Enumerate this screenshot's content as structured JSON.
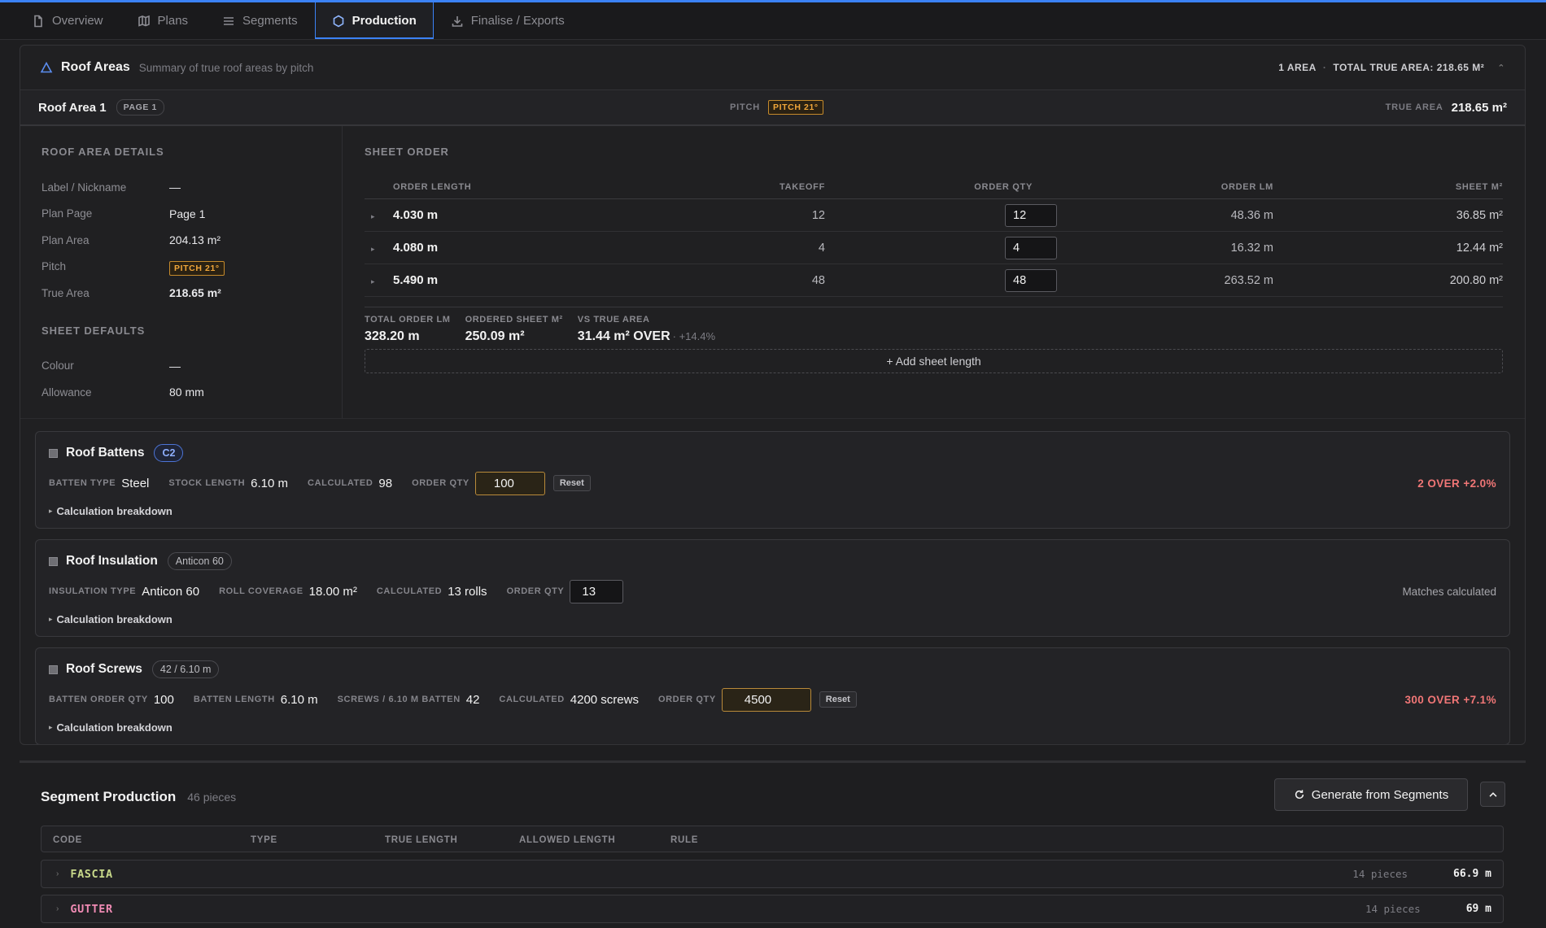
{
  "tabs": [
    {
      "label": "Overview",
      "icon": "document-icon"
    },
    {
      "label": "Plans",
      "icon": "map-icon"
    },
    {
      "label": "Segments",
      "icon": "list-icon"
    },
    {
      "label": "Production",
      "icon": "hexagon-icon"
    },
    {
      "label": "Finalise / Exports",
      "icon": "download-icon"
    }
  ],
  "roof_areas": {
    "title": "Roof Areas",
    "subtitle": "Summary of true roof areas by pitch",
    "area_count": "1 AREA",
    "total_true_area": "TOTAL TRUE AREA: 218.65 M²"
  },
  "area": {
    "name": "Roof Area 1",
    "page_pill": "PAGE 1",
    "pitch_caption": "PITCH",
    "pitch_badge": "PITCH 21°",
    "true_area_caption": "TRUE AREA",
    "true_area": "218.65 m²"
  },
  "details": {
    "heading": "ROOF AREA DETAILS",
    "rows": [
      {
        "key": "Label / Nickname",
        "value": "—"
      },
      {
        "key": "Plan Page",
        "value": "Page 1"
      },
      {
        "key": "Plan Area",
        "value": "204.13 m²"
      },
      {
        "key": "Pitch",
        "value": "PITCH 21°"
      },
      {
        "key": "True Area",
        "value": "218.65 m²"
      }
    ],
    "defaults_heading": "SHEET DEFAULTS",
    "defaults": [
      {
        "key": "Colour",
        "value": "—"
      },
      {
        "key": "Allowance",
        "value": "80 mm"
      }
    ]
  },
  "sheet_order": {
    "heading": "SHEET ORDER",
    "columns": [
      "ORDER LENGTH",
      "TAKEOFF",
      "ORDER QTY",
      "ORDER LM",
      "SHEET M²"
    ],
    "rows": [
      {
        "length": "4.030 m",
        "takeoff": "12",
        "qty": "12",
        "lm": "48.36 m",
        "m2": "36.85 m²"
      },
      {
        "length": "4.080 m",
        "takeoff": "4",
        "qty": "4",
        "lm": "16.32 m",
        "m2": "12.44 m²"
      },
      {
        "length": "5.490 m",
        "takeoff": "48",
        "qty": "48",
        "lm": "263.52 m",
        "m2": "200.80 m²"
      }
    ],
    "totals": [
      {
        "caption": "TOTAL ORDER LM",
        "value": "328.20 m"
      },
      {
        "caption": "ORDERED SHEET M²",
        "value": "250.09 m²"
      },
      {
        "caption": "VS TRUE AREA",
        "value": "31.44 m² OVER",
        "extra": "· +14.4%"
      }
    ],
    "add_label": "+ Add sheet length"
  },
  "battens": {
    "name": "Roof Battens",
    "chip": "C2",
    "type_caption": "BATTEN TYPE",
    "type": "Steel",
    "stock_caption": "STOCK LENGTH",
    "stock": "6.10 m",
    "calc_caption": "CALCULATED",
    "calc": "98",
    "qty_caption": "ORDER QTY",
    "qty": "100",
    "reset": "Reset",
    "status": "2 OVER  +2.0%",
    "breakdown": "Calculation breakdown"
  },
  "insulation": {
    "name": "Roof Insulation",
    "chip": "Anticon 60",
    "type_caption": "INSULATION TYPE",
    "type": "Anticon 60",
    "coverage_caption": "ROLL COVERAGE",
    "coverage": "18.00 m²",
    "calc_caption": "CALCULATED",
    "calc": "13 rolls",
    "qty_caption": "ORDER QTY",
    "qty": "13",
    "status": "Matches calculated",
    "breakdown": "Calculation breakdown"
  },
  "screws": {
    "name": "Roof Screws",
    "chip": "42 / 6.10 m",
    "batten_qty_caption": "BATTEN ORDER QTY",
    "batten_qty": "100",
    "batten_len_caption": "BATTEN LENGTH",
    "batten_len": "6.10 m",
    "per_caption": "SCREWS / 6.10 M BATTEN",
    "per": "42",
    "calc_caption": "CALCULATED",
    "calc": "4200 screws",
    "qty_caption": "ORDER QTY",
    "qty": "4500",
    "reset": "Reset",
    "status": "300 OVER  +7.1%",
    "breakdown": "Calculation breakdown"
  },
  "segment_production": {
    "title": "Segment Production",
    "count": "46 pieces",
    "generate_label": "Generate from Segments",
    "columns": [
      "CODE",
      "TYPE",
      "TRUE LENGTH",
      "ALLOWED LENGTH",
      "RULE"
    ],
    "rows": [
      {
        "code": "FASCIA",
        "pieces": "14 pieces",
        "length": "66.9 m",
        "color": "#c8d98a"
      },
      {
        "code": "GUTTER",
        "pieces": "14 pieces",
        "length": "69 m",
        "color": "#f08bb4"
      }
    ]
  }
}
